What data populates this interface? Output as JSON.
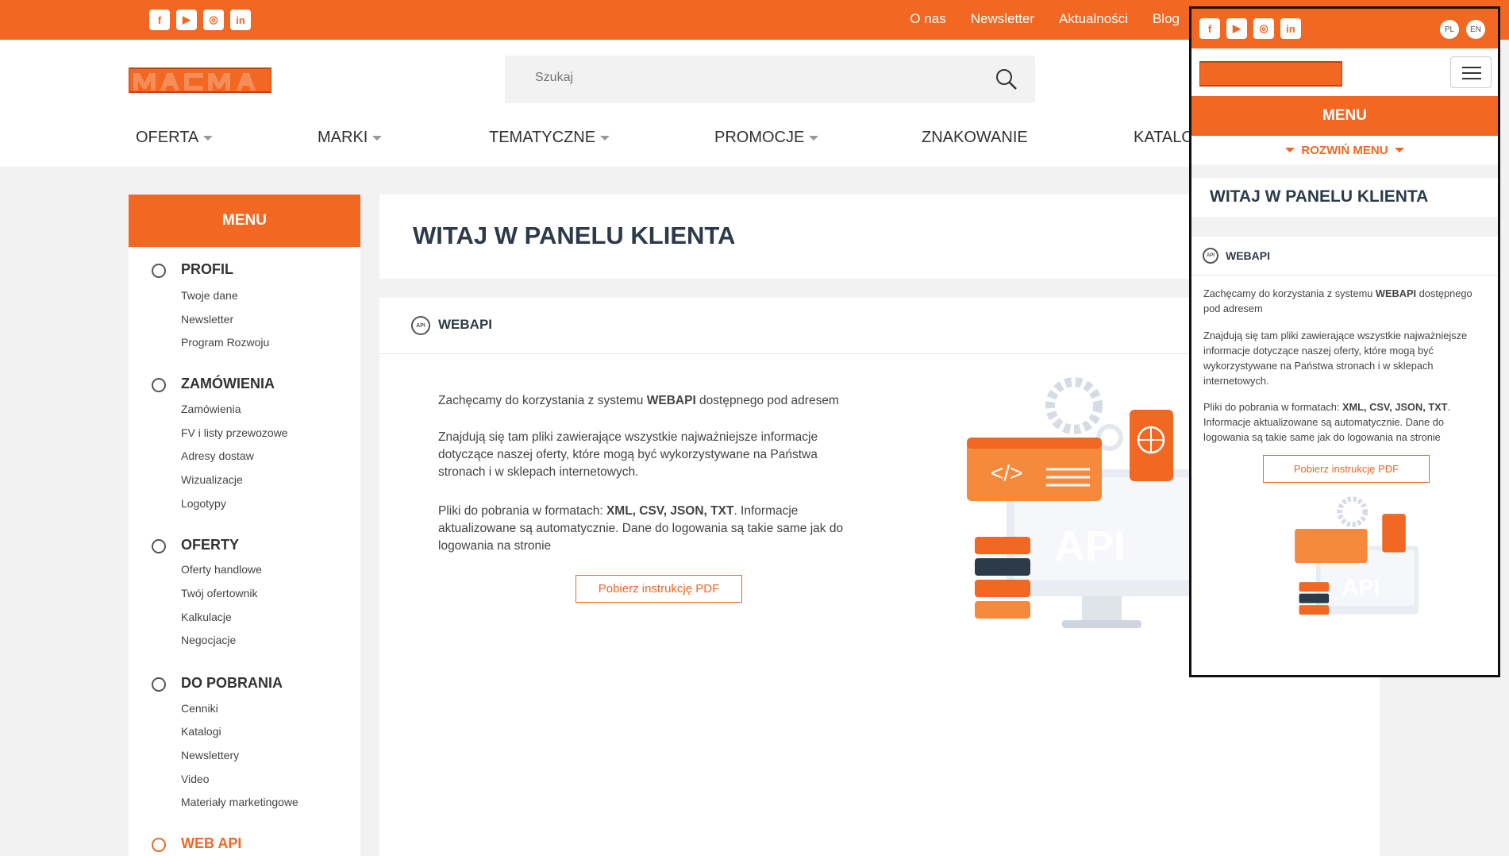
{
  "social": {
    "facebook": "f",
    "youtube": "▶",
    "instagram": "◎",
    "linkedin": "in"
  },
  "toplinks": [
    "O nas",
    "Newsletter",
    "Aktualności",
    "Blog"
  ],
  "search": {
    "placeholder": "Szukaj"
  },
  "nav": {
    "oferta": "OFERTA",
    "marki": "MARKI",
    "tematyczne": "TEMATYCZNE",
    "promocje": "PROMOCJE",
    "znakowanie": "ZNAKOWANIE",
    "katalogi": "KATALO"
  },
  "sidebar": {
    "menu": "MENU",
    "profil": {
      "title": "PROFIL",
      "items": [
        "Twoje dane",
        "Newsletter",
        "Program Rozwoju"
      ]
    },
    "zamowienia": {
      "title": "ZAMÓWIENIA",
      "items": [
        "Zamówienia",
        "FV i listy przewozowe",
        "Adresy dostaw",
        "Wizualizacje",
        "Logotypy"
      ]
    },
    "oferty": {
      "title": "OFERTY",
      "items": [
        "Oferty handlowe",
        "Twój ofertownik",
        "Kalkulacje",
        "Negocjacje"
      ]
    },
    "pobrania": {
      "title": "DO POBRANIA",
      "items": [
        "Cenniki",
        "Katalogi",
        "Newslettery",
        "Video",
        "Materiały marketingowe"
      ]
    },
    "webapi": {
      "title": "WEB API"
    }
  },
  "main": {
    "welcome": "WITAJ W PANELU KLIENTA",
    "section_title": "WEBAPI",
    "p1_a": "Zachęcamy do korzystania z systemu ",
    "p1_b": "WEBAPI",
    "p1_c": " dostępnego pod adresem",
    "p2": "Znajdują się tam pliki zawierające wszystkie najważniejsze informacje dotyczące naszej oferty, które mogą być wykorzystywane na Państwa stronach i w sklepach internetowych.",
    "p3_a": "Pliki do pobrania w formatach: ",
    "p3_b": "XML, CSV, JSON, TXT",
    "p3_c": ". Informacje aktualizowane są automatycznie. Dane do logowania są takie same jak do logowania na stronie",
    "pdf_button": "Pobierz instrukcję PDF",
    "illustration_text": "API",
    "code_glyph": "</>"
  },
  "mobile": {
    "lang_pl": "PL",
    "lang_en": "EN",
    "menu": "MENU",
    "expand": "ROZWIŃ MENU"
  },
  "colors": {
    "accent": "#f26722",
    "heading": "#2d3a4a"
  }
}
